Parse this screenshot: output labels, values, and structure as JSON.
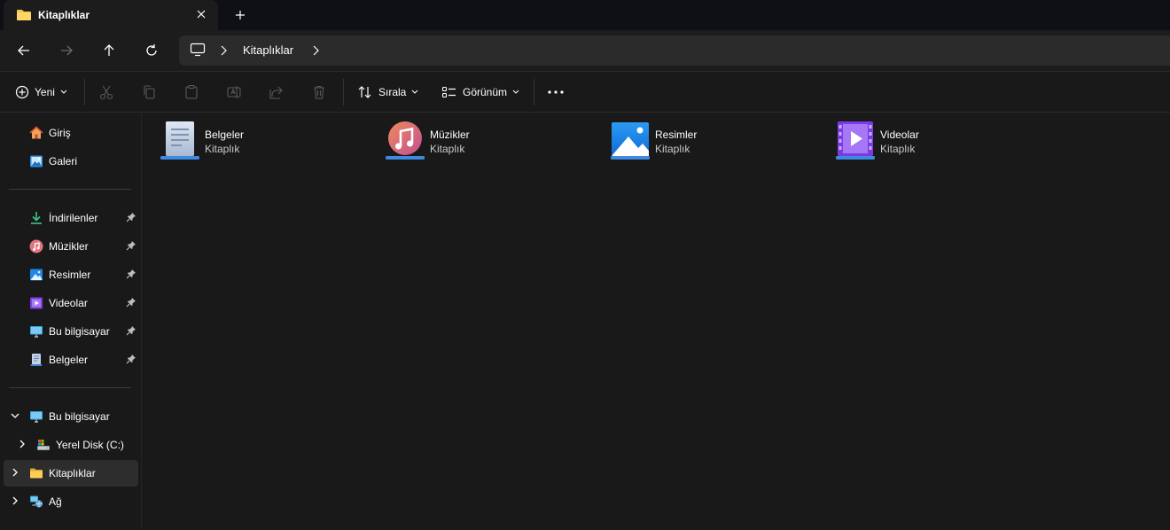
{
  "tab": {
    "title": "Kitaplıklar",
    "close_icon": "close-icon",
    "new_tab_icon": "plus-icon"
  },
  "nav": {
    "back_icon": "arrow-left-icon",
    "forward_icon": "arrow-right-icon",
    "up_icon": "arrow-up-icon",
    "refresh_icon": "refresh-icon",
    "breadcrumb": [
      "Kitaplıklar"
    ]
  },
  "commandbar": {
    "new_label": "Yeni",
    "sort_label": "Sırala",
    "view_label": "Görünüm",
    "more_icon": "more-icon"
  },
  "sidebar": {
    "top": [
      {
        "label": "Giriş",
        "icon": "home-icon"
      },
      {
        "label": "Galeri",
        "icon": "gallery-icon"
      }
    ],
    "quick": [
      {
        "label": "İndirilenler",
        "icon": "download-icon"
      },
      {
        "label": "Müzikler",
        "icon": "music-icon"
      },
      {
        "label": "Resimler",
        "icon": "pictures-icon"
      },
      {
        "label": "Videolar",
        "icon": "videos-icon"
      },
      {
        "label": "Bu bilgisayar",
        "icon": "monitor-icon"
      },
      {
        "label": "Belgeler",
        "icon": "documents-icon"
      }
    ],
    "tree": [
      {
        "label": "Bu bilgisayar",
        "icon": "monitor-icon",
        "expanded": true
      },
      {
        "label": "Yerel Disk (C:)",
        "icon": "drive-icon"
      },
      {
        "label": "Kitaplıklar",
        "icon": "folder-icon",
        "selected": true
      },
      {
        "label": "Ağ",
        "icon": "network-icon"
      }
    ]
  },
  "libraries": [
    {
      "name": "Belgeler",
      "type": "Kitaplık",
      "icon": "documents-library-icon"
    },
    {
      "name": "Müzikler",
      "type": "Kitaplık",
      "icon": "music-library-icon"
    },
    {
      "name": "Resimler",
      "type": "Kitaplık",
      "icon": "pictures-library-icon"
    },
    {
      "name": "Videolar",
      "type": "Kitaplık",
      "icon": "videos-library-icon"
    }
  ],
  "colors": {
    "accent": "#4cc2ff",
    "folder": "#f8c44f",
    "background": "#191919",
    "selected": "#2d2d2d"
  }
}
